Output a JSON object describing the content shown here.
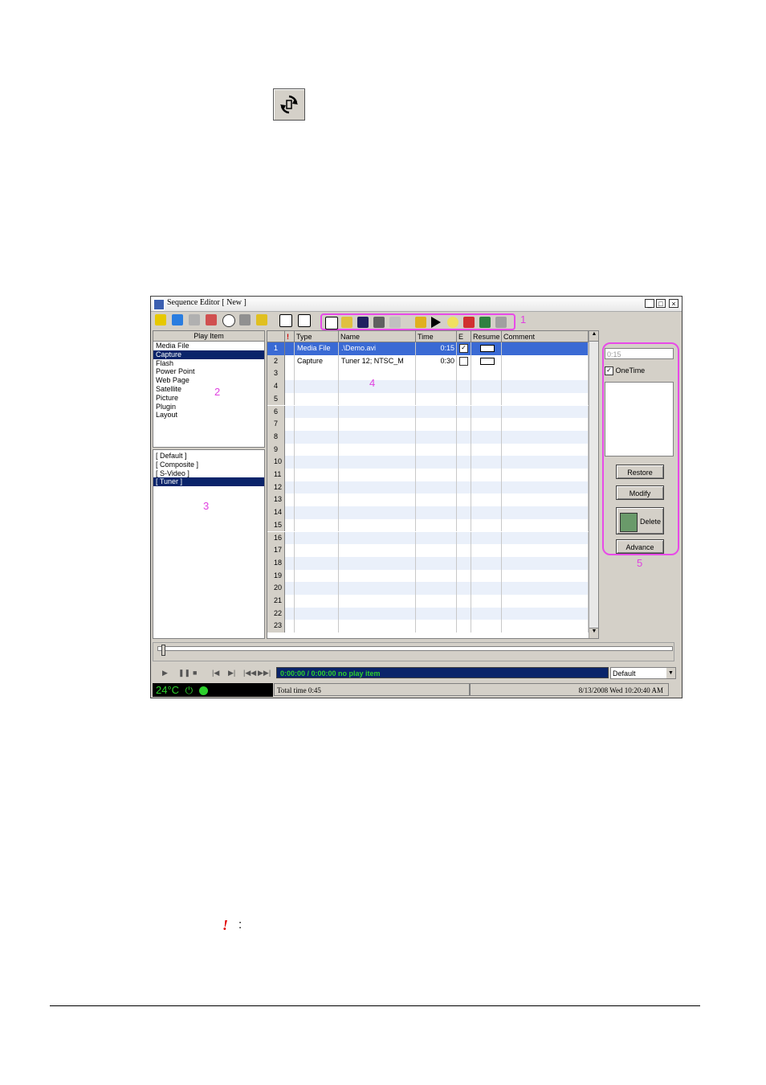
{
  "window": {
    "title": "Sequence Editor [ New ]",
    "controls": [
      "_",
      "□",
      "×"
    ]
  },
  "annotations": {
    "toolbar": "1",
    "play_item": "2",
    "source": "3",
    "grid": "4",
    "properties": "5"
  },
  "play_item": {
    "header": "Play Item",
    "items": [
      "Media File",
      "Capture",
      "Flash",
      "Power Point",
      "Web Page",
      "Satellite",
      "Picture",
      "Plugin",
      "Layout"
    ],
    "selected": "Capture"
  },
  "sources": {
    "items": [
      "[ Default ]",
      "[ Composite ]",
      "[ S-Video ]",
      "[ Tuner ]"
    ],
    "selected": "[ Tuner ]"
  },
  "grid": {
    "columns": [
      "!",
      "Type",
      "Name",
      "Time",
      "E",
      "Resume",
      "Comment"
    ],
    "rows": [
      {
        "n": "1",
        "type": "Media File",
        "name": ".\\Demo.avi",
        "time": "0:15",
        "e": true
      },
      {
        "n": "2",
        "type": "Capture",
        "name": "Tuner 12; NTSC_M",
        "time": "0:30",
        "e": false
      }
    ],
    "empty_rows": [
      "3",
      "4",
      "5",
      "6",
      "7",
      "8",
      "9",
      "10",
      "11",
      "12",
      "13",
      "14",
      "15",
      "16",
      "17",
      "18",
      "19",
      "20",
      "21",
      "22",
      "23"
    ]
  },
  "props": {
    "time_value": "0:15",
    "onetime_label": "OneTime",
    "restore": "Restore",
    "modify": "Modify",
    "delete": "Delete",
    "advance": "Advance"
  },
  "player": {
    "status": "0:00:00 / 0:00:00   no play item",
    "output": "Default"
  },
  "statusbar": {
    "temp": "24°C",
    "total": "Total time 0:45",
    "datetime": "8/13/2008 Wed 10:20:40 AM"
  },
  "footnote": {
    "symbol": "!",
    "colon": ":"
  }
}
